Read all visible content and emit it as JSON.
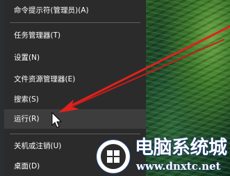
{
  "menu": {
    "items": [
      {
        "label": "命令提示符(管理员)(A)"
      },
      {
        "label": "任务管理器(T)"
      },
      {
        "label": "设置(N)"
      },
      {
        "label": "文件资源管理器(E)"
      },
      {
        "label": "搜索(S)"
      },
      {
        "label": "运行(R)"
      },
      {
        "label": "关机或注销(U)"
      },
      {
        "label": "桌面(D)"
      }
    ],
    "hovered_item": "运行(R)"
  },
  "watermark": {
    "title": "电脑系统城",
    "url": "www.dnxtc.net"
  },
  "colors": {
    "menu_bg": "#2b2b2b",
    "menu_hover": "#3d3d3d",
    "menu_text": "#ffffff",
    "arrow": "#e0211d",
    "watermark_outline": "#1a3a6a"
  },
  "icons": [
    "mouse-pointer-icon",
    "windows-logo-icon",
    "red-arrow-annotation"
  ]
}
